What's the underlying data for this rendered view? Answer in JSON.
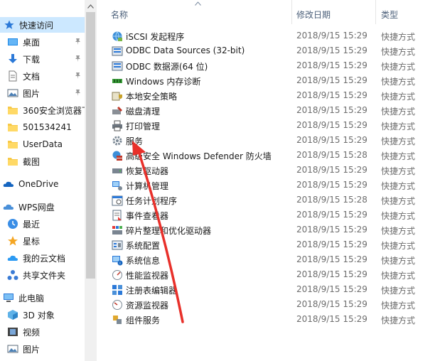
{
  "sidebar": {
    "quick_access": "快速访问",
    "items": [
      {
        "label": "桌面",
        "icon": "desktop-icon",
        "pinned": true
      },
      {
        "label": "下载",
        "icon": "download-icon",
        "pinned": true
      },
      {
        "label": "文档",
        "icon": "document-icon",
        "pinned": true
      },
      {
        "label": "图片",
        "icon": "pictures-icon",
        "pinned": true
      },
      {
        "label": "360安全浏览器下",
        "icon": "folder-icon",
        "pinned": false
      },
      {
        "label": "501534241",
        "icon": "folder-icon",
        "pinned": false
      },
      {
        "label": "UserData",
        "icon": "folder-icon",
        "pinned": false
      },
      {
        "label": "截图",
        "icon": "folder-icon",
        "pinned": false
      }
    ],
    "onedrive": "OneDrive",
    "wps": "WPS网盘",
    "wps_items": [
      {
        "label": "最近",
        "icon": "clock-icon"
      },
      {
        "label": "星标",
        "icon": "star-icon"
      },
      {
        "label": "我的云文档",
        "icon": "cloud-doc-icon"
      },
      {
        "label": "共享文件夹",
        "icon": "share-icon"
      }
    ],
    "this_pc": "此电脑",
    "pc_items": [
      {
        "label": "3D 对象",
        "icon": "cube-3d-icon"
      },
      {
        "label": "视频",
        "icon": "video-icon"
      },
      {
        "label": "图片",
        "icon": "pictures-icon"
      }
    ]
  },
  "columns": {
    "name": "名称",
    "modified": "修改日期",
    "type": "类型"
  },
  "files": [
    {
      "name": "iSCSI 发起程序",
      "date": "2018/9/15 15:29",
      "type": "快捷方式",
      "icon": "iscsi-globe-icon"
    },
    {
      "name": "ODBC Data Sources (32-bit)",
      "date": "2018/9/15 15:29",
      "type": "快捷方式",
      "icon": "odbc-icon"
    },
    {
      "name": "ODBC 数据源(64 位)",
      "date": "2018/9/15 15:29",
      "type": "快捷方式",
      "icon": "odbc-icon"
    },
    {
      "name": "Windows 内存诊断",
      "date": "2018/9/15 15:29",
      "type": "快捷方式",
      "icon": "memory-diagnostic-icon"
    },
    {
      "name": "本地安全策略",
      "date": "2018/9/15 15:29",
      "type": "快捷方式",
      "icon": "security-policy-icon"
    },
    {
      "name": "磁盘清理",
      "date": "2018/9/15 15:29",
      "type": "快捷方式",
      "icon": "disk-cleanup-icon"
    },
    {
      "name": "打印管理",
      "date": "2018/9/15 15:29",
      "type": "快捷方式",
      "icon": "printer-icon"
    },
    {
      "name": "服务",
      "date": "2018/9/15 15:29",
      "type": "快捷方式",
      "icon": "services-gear-icon"
    },
    {
      "name": "高级安全 Windows Defender 防火墙",
      "date": "2018/9/15 15:28",
      "type": "快捷方式",
      "icon": "firewall-icon"
    },
    {
      "name": "恢复驱动器",
      "date": "2018/9/15 15:29",
      "type": "快捷方式",
      "icon": "recovery-drive-icon"
    },
    {
      "name": "计算机管理",
      "date": "2018/9/15 15:29",
      "type": "快捷方式",
      "icon": "computer-management-icon"
    },
    {
      "name": "任务计划程序",
      "date": "2018/9/15 15:28",
      "type": "快捷方式",
      "icon": "task-scheduler-icon"
    },
    {
      "name": "事件查看器",
      "date": "2018/9/15 15:29",
      "type": "快捷方式",
      "icon": "event-viewer-icon"
    },
    {
      "name": "碎片整理和优化驱动器",
      "date": "2018/9/15 15:29",
      "type": "快捷方式",
      "icon": "defrag-icon"
    },
    {
      "name": "系统配置",
      "date": "2018/9/15 15:29",
      "type": "快捷方式",
      "icon": "system-config-icon"
    },
    {
      "name": "系统信息",
      "date": "2018/9/15 15:29",
      "type": "快捷方式",
      "icon": "system-info-icon"
    },
    {
      "name": "性能监视器",
      "date": "2018/9/15 15:29",
      "type": "快捷方式",
      "icon": "performance-monitor-icon"
    },
    {
      "name": "注册表编辑器",
      "date": "2018/9/15 15:29",
      "type": "快捷方式",
      "icon": "registry-editor-icon"
    },
    {
      "name": "资源监视器",
      "date": "2018/9/15 15:29",
      "type": "快捷方式",
      "icon": "resource-monitor-icon"
    },
    {
      "name": "组件服务",
      "date": "2018/9/15 15:29",
      "type": "快捷方式",
      "icon": "component-services-icon"
    }
  ],
  "colors": {
    "selection": "#cce8ff",
    "header_text": "#4c607a",
    "secondary_text": "#6d6d6d",
    "annotation_arrow": "#e8302a"
  }
}
